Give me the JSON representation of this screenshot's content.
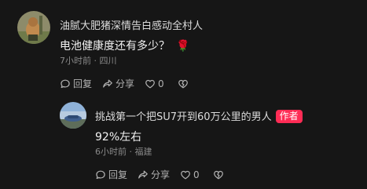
{
  "comments": [
    {
      "username": "油腻大肥猪深情告白感动全村人",
      "text": "电池健康度还有多少？",
      "emoji_icon": "rose-icon",
      "emoji_glyph": "🌹",
      "time": "7小时前",
      "separator": "·",
      "location": "四川",
      "reply_label": "回复",
      "share_label": "分享",
      "like_count": "0"
    },
    {
      "username": "挑战第一个把SU7开到60万公里的男人",
      "author_badge": "作者",
      "text": "92%左右",
      "time": "6小时前",
      "separator": "·",
      "location": "福建",
      "reply_label": "回复",
      "share_label": "分享",
      "like_count": "0"
    }
  ],
  "colors": {
    "background": "#161616",
    "author_badge": "#fe2c55",
    "secondary_text": "#8a8a8a"
  }
}
